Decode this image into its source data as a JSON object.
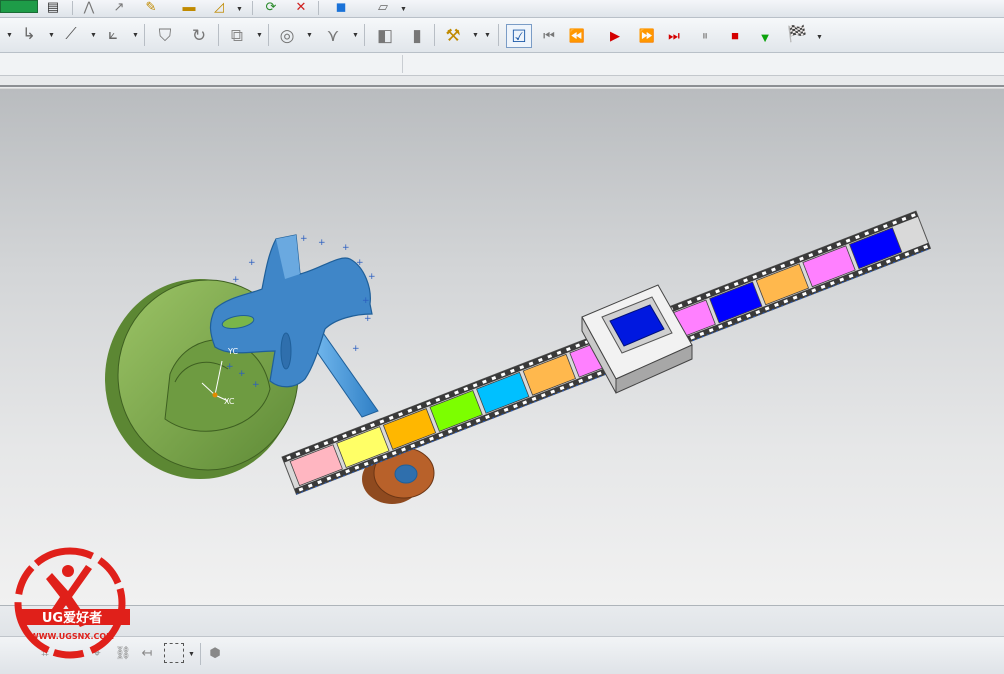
{
  "toolbar_top": {
    "icons": [
      "layer-icon",
      "page-icon",
      "sketch-icon",
      "curve-icon",
      "magic-icon",
      "ruler-icon",
      "draft-icon",
      "refresh-icon",
      "delete-icon",
      "cube-view-icon",
      "render-icon"
    ]
  },
  "toolbar_main": {
    "groups": [
      {
        "icons": [
          "point-icon",
          "line-icon",
          "axis-icon"
        ]
      },
      {
        "icons": [
          "extrude-icon",
          "revolve-icon",
          "boolean-icon"
        ]
      },
      {
        "icons": [
          "pattern-icon",
          "spline-icon",
          "face-icon",
          "offset-icon"
        ]
      },
      {
        "icons": [
          "measure-icon"
        ]
      }
    ]
  },
  "playback": {
    "buttons": [
      {
        "name": "rewind-to-start",
        "glyph": "⏮"
      },
      {
        "name": "step-back",
        "glyph": "⏪"
      },
      {
        "name": "play",
        "glyph": "▶"
      },
      {
        "name": "step-forward",
        "glyph": "⏩"
      },
      {
        "name": "fast-forward",
        "glyph": "⏭"
      },
      {
        "name": "pause",
        "glyph": "⏸"
      },
      {
        "name": "stop",
        "glyph": "■"
      },
      {
        "name": "export",
        "glyph": "▼"
      },
      {
        "name": "finish",
        "glyph": "🏁"
      }
    ]
  },
  "triad": {
    "x_label": "XC",
    "y_label": "YC"
  },
  "watermark": {
    "brand": "UG爱好者",
    "url": "WWW.UGSNX.COM"
  },
  "film_frames": [
    "#ffb6c1",
    "#ffff66",
    "#ffb700",
    "#7cff00",
    "#00c0ff",
    "#ffb84d",
    "#ff80ff",
    "#ffb84d",
    "#ff80ff",
    "#0000ff",
    "#ffb84d",
    "#ff80ff",
    "#0000ff"
  ],
  "colors": {
    "cam": "#7dab4c",
    "geneva": "#3f86c8",
    "shaft": "#5aa9e6",
    "roller": "#b8612a",
    "box_hole": "#0018e0"
  }
}
